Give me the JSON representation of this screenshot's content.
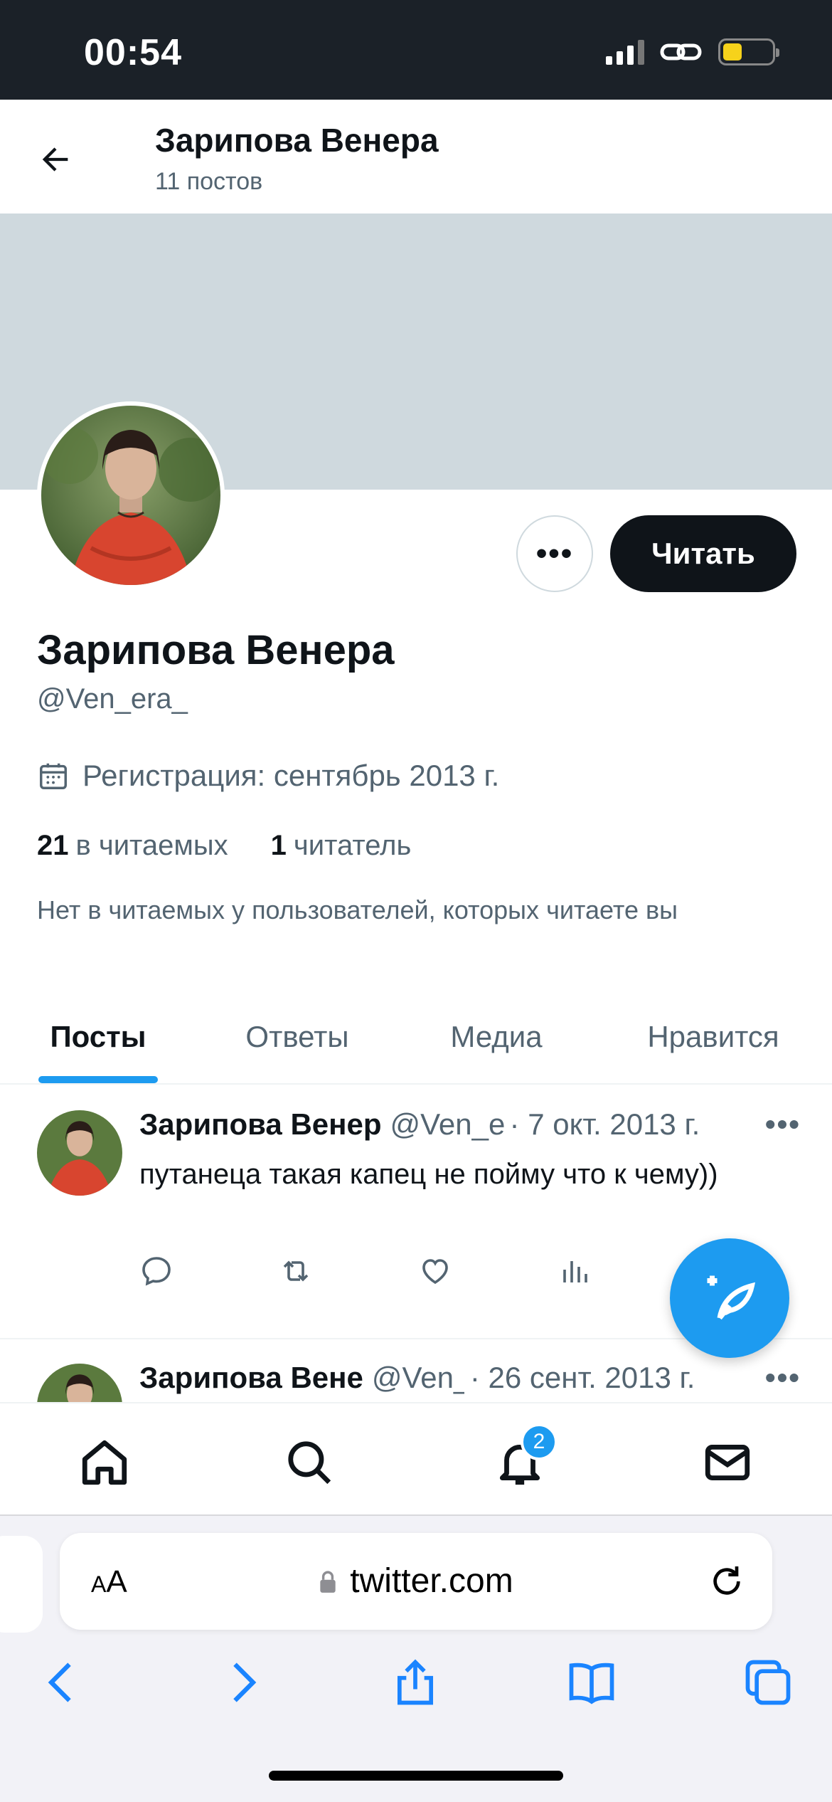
{
  "status_bar": {
    "time": "00:54"
  },
  "header": {
    "title": "Зарипова Венера",
    "subtitle": "11 постов"
  },
  "profile": {
    "more_label": "•••",
    "follow_label": "Читать",
    "name": "Зарипова Венера",
    "handle": "@Ven_era_",
    "joined": "Регистрация: сентябрь 2013 г.",
    "following_count": "21",
    "following_label": "в читаемых",
    "followers_count": "1",
    "followers_label": "читатель",
    "mutuals_text": "Нет в читаемых у пользователей, которых читаете вы"
  },
  "tabs": [
    {
      "label": "Посты",
      "active": true
    },
    {
      "label": "Ответы",
      "active": false
    },
    {
      "label": "Медиа",
      "active": false
    },
    {
      "label": "Нравится",
      "active": false
    }
  ],
  "tweets": [
    {
      "name": "Зарипова Венер",
      "handle": "@Ven_er",
      "date": "· 7 окт. 2013 г.",
      "more": "•••",
      "text": "путанеца такая капец не пойму что к чему))"
    },
    {
      "name": "Зарипова Вене",
      "handle": "@Ven_",
      "date": "· 26 сент. 2013 г.",
      "more": "•••",
      "text": ""
    }
  ],
  "bottom_nav": {
    "notifications_badge": "2"
  },
  "browser": {
    "text_size_label_small": "A",
    "text_size_label_large": "A",
    "url": "twitter.com"
  },
  "colors": {
    "accent": "#1d9bf0",
    "banner": "#cfd9de",
    "text_secondary": "#536471"
  },
  "icons": [
    "back-arrow-icon",
    "calendar-icon",
    "reply-icon",
    "retweet-icon",
    "like-icon",
    "views-icon",
    "compose-icon",
    "home-icon",
    "search-icon",
    "bell-icon",
    "mail-icon",
    "lock-icon",
    "reload-icon",
    "safari-back-icon",
    "safari-forward-icon",
    "share-icon",
    "bookmarks-icon",
    "tabs-icon"
  ]
}
